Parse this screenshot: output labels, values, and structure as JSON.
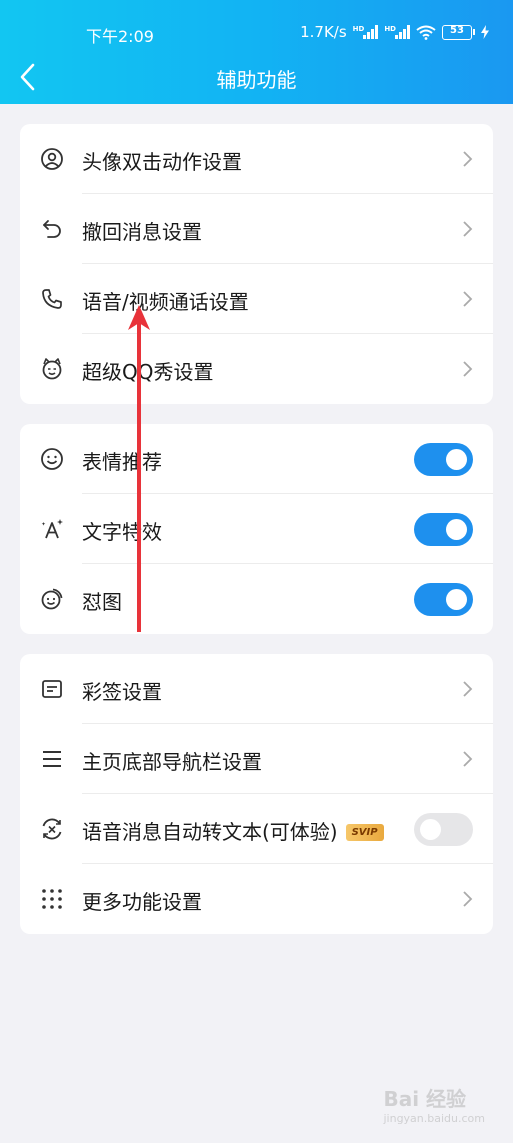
{
  "status_bar": {
    "time": "下午2:09",
    "speed": "1.7K/s",
    "sim1": "HD",
    "sim2": "HD",
    "battery": "53"
  },
  "header": {
    "title": "辅助功能",
    "back_icon": "chevron-left-icon"
  },
  "group1": {
    "items": [
      {
        "label": "头像双击动作设置",
        "icon": "avatar-circle-icon"
      },
      {
        "label": "撤回消息设置",
        "icon": "undo-icon"
      },
      {
        "label": "语音/视频通话设置",
        "icon": "phone-icon"
      },
      {
        "label": "超级QQ秀设置",
        "icon": "qq-show-icon"
      }
    ]
  },
  "group2": {
    "items": [
      {
        "label": "表情推荐",
        "icon": "smiley-icon",
        "enabled": true
      },
      {
        "label": "文字特效",
        "icon": "text-effect-icon",
        "enabled": true
      },
      {
        "label": "怼图",
        "icon": "sticker-icon",
        "enabled": true
      }
    ]
  },
  "group3": {
    "items": [
      {
        "label": "彩签设置",
        "icon": "label-card-icon"
      },
      {
        "label": "主页底部导航栏设置",
        "icon": "menu-lines-icon"
      },
      {
        "label": "语音消息自动转文本(可体验)",
        "icon": "voice-to-text-icon",
        "badge": "SVIP",
        "enabled": false
      },
      {
        "label": "更多功能设置",
        "icon": "grid-dots-icon"
      }
    ]
  },
  "colors": {
    "header_start": "#12c6f2",
    "header_end": "#1a98f1",
    "toggle_on": "#1e90ee",
    "annotation_arrow": "#e8333a"
  },
  "watermark": {
    "brand": "Bai 经验",
    "sub": "jingyan.baidu.com"
  }
}
